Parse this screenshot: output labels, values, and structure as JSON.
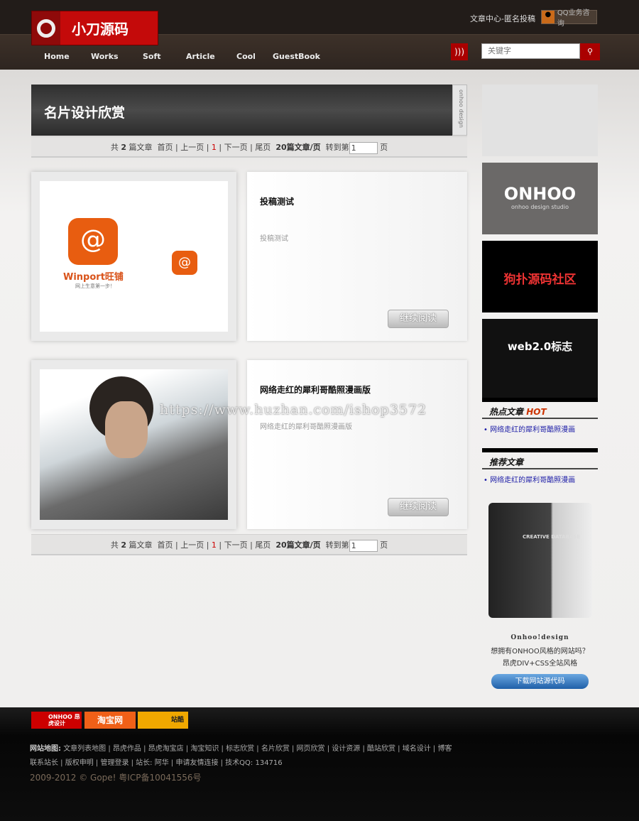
{
  "header": {
    "logo_text": "小刀源码",
    "top_link": "文章中心-匿名投稿",
    "qq_button": "QQ业务咨询",
    "nav": [
      "Home",
      "Works",
      "Soft",
      "Article",
      "Cool",
      "GuestBook"
    ],
    "search_placeholder": "关键字"
  },
  "main": {
    "title": "名片设计欣赏",
    "title_side": "onhoo design",
    "pager": {
      "total_prefix": "共",
      "total": "2",
      "total_suffix": "篇文章",
      "first": "首页",
      "prev": "上一页",
      "current": "1",
      "next": "下一页",
      "last": "尾页",
      "per_page": "20篇文章/页",
      "goto": "转到第",
      "goto_value": "1",
      "page_suffix": "页"
    },
    "articles": [
      {
        "title": "投稿测试",
        "summary": "投稿测试",
        "more": "继续阅读",
        "image_text": "Winport旺铺",
        "image_sub": "网上生意第一步！"
      },
      {
        "title": "网络走红的犀利哥酷照漫画版",
        "summary": "网络走红的犀利哥酷照漫画版",
        "more": "继续阅读"
      }
    ]
  },
  "sidebar": {
    "ad1": "ONHOO",
    "ad1_sub": "onhoo design studio",
    "ad2": "狗扑源码社区",
    "ad3": "web2.0标志",
    "hot_title": "热点文章",
    "hot_tag": "HOT",
    "hot_items": [
      "网络走红的犀利哥酷照漫画"
    ],
    "rec_title": "推荐文章",
    "rec_items": [
      "网络走红的犀利哥酷照漫画"
    ],
    "promo": {
      "book": "CREATIVE DATABASE",
      "brand": "Onhoo!design",
      "line1": "想拥有ONHOO风格的网站吗？",
      "line2": "昂虎DIV+CSS全站风格",
      "button": "下载网站源代码"
    }
  },
  "footer": {
    "badges": [
      "ONHOO 昂虎设计",
      "淘宝网",
      "站酷"
    ],
    "sitemap_label": "网站地图:",
    "links1": "文章列表地图 | 昂虎作品 | 昂虎淘宝店 | 淘宝知识 | 标志欣赏 | 名片欣赏 | 网页欣赏 | 设计资源 | 酷站欣赏 | 域名设计 | 博客",
    "links2": "联系站长 | 版权申明 | 管理登录 | 站长: 阿华 | 申请友情连接 | 技术QQ: 134716",
    "copyright": "2009-2012 © Gope! 粤ICP备10041556号"
  },
  "watermark": "https://www.huzhan.com/ishop3572"
}
